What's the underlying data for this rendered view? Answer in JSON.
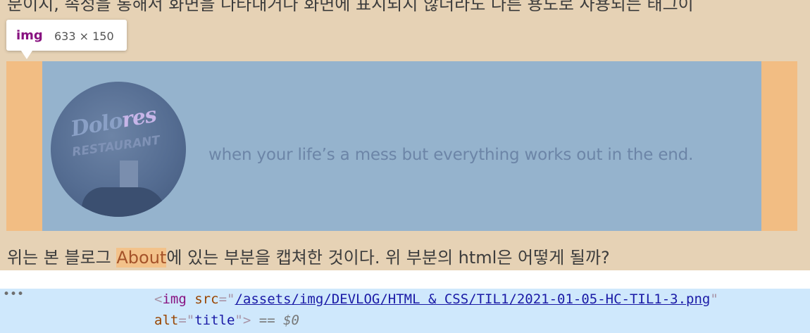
{
  "page": {
    "top_text": "분이지, 속성을 통해서 화면을 나타내거나 화면에 표시되지 않더라도 다른 용도로 사용되는 태그이",
    "tooltip": {
      "tag": "img",
      "dimensions": "633 × 150"
    },
    "image": {
      "sign_top": "Dolo",
      "sign_top_accent": "res",
      "sign_bottom_prefix": "RES",
      "sign_bottom": "TAURANT",
      "tagline": "when your life’s a mess but everything works out in the end."
    },
    "bottom_text": {
      "before": "위는 본 블로그 ",
      "link": "About",
      "after": "에 있는 부분을 캡쳐한 것이다. 위 부분의 html은 어떻게 될까?"
    }
  },
  "devtools": {
    "ellipsis": "•••",
    "line1": {
      "open": "<",
      "tag": "img",
      "attr_src": "src",
      "eq": "=\"",
      "src_value": "/assets/img/DEVLOG/HTML & CSS/TIL1/2021-01-05-HC-TIL1-3.png",
      "close_quote": "\""
    },
    "line2": {
      "attr_alt": "alt",
      "eq": "=\"",
      "alt_value": "title",
      "close": "\">",
      "equals": " == ",
      "ref": "$0"
    }
  },
  "colors": {
    "page_background": "#e6d2b5",
    "margin_highlight": "#f2bd83",
    "content_highlight": "#95b3cd",
    "devtools_selected_row": "#cfe8fc"
  }
}
